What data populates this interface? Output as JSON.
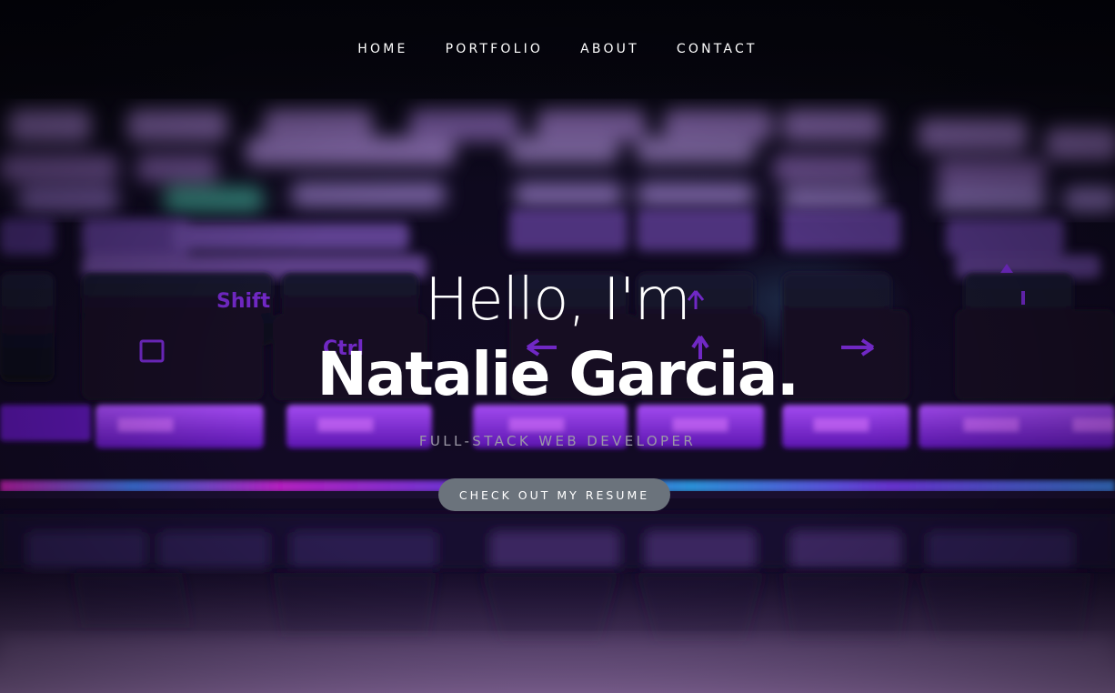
{
  "nav": {
    "items": [
      {
        "label": "HOME"
      },
      {
        "label": "PORTFOLIO"
      },
      {
        "label": "ABOUT"
      },
      {
        "label": "CONTACT"
      }
    ]
  },
  "hero": {
    "greeting": "Hello, I'm",
    "name": "Natalie Garcia.",
    "role": "FULL-STACK WEB DEVELOPER",
    "cta_label": "CHECK OUT MY RESUME",
    "background": {
      "accent_purple": "#7a2bd6",
      "accent_magenta": "#d025c8",
      "accent_cyan": "#3aa0e0"
    },
    "keycaps": [
      {
        "label": "Shift"
      },
      {
        "label": "Ctrl"
      }
    ]
  }
}
